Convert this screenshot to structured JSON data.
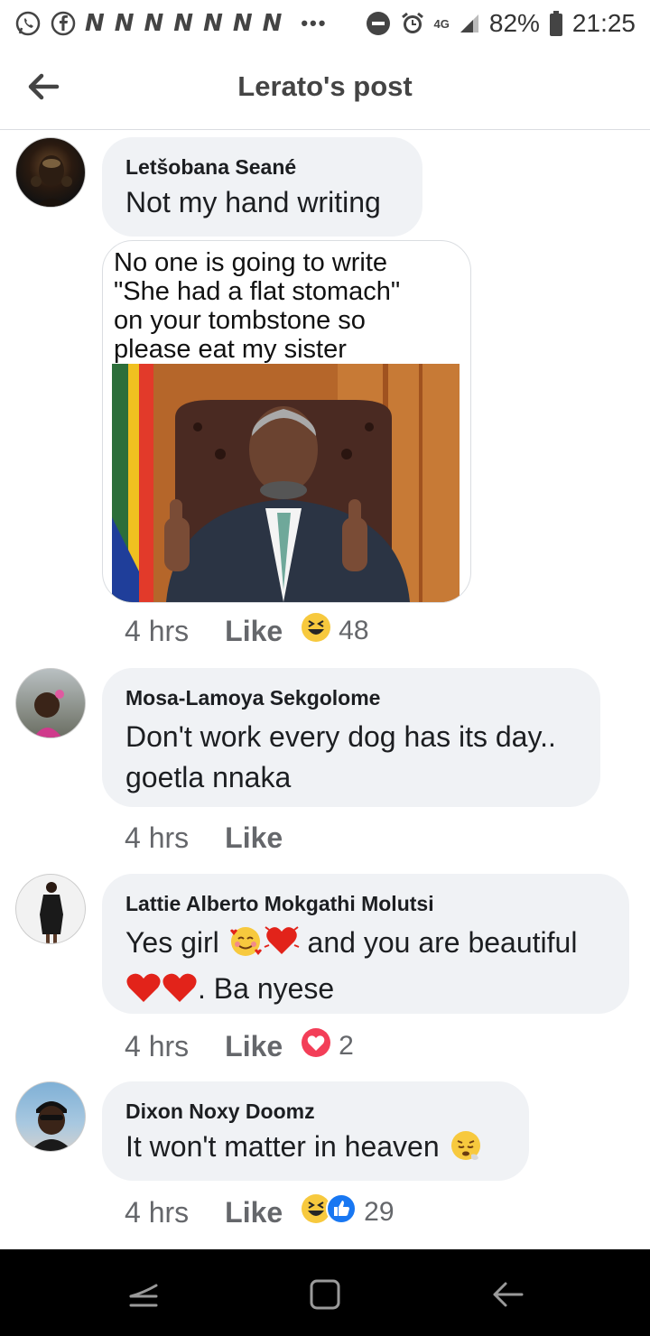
{
  "status_bar": {
    "notification_letters": [
      "N",
      "N",
      "N",
      "N",
      "N",
      "N",
      "N"
    ],
    "more_indicator": "•••",
    "network": "4G",
    "battery": "82%",
    "time": "21:25"
  },
  "header": {
    "title": "Lerato's post"
  },
  "comments": [
    {
      "author": "Letšobana Seané",
      "text": "Not my hand writing",
      "meme_text": "No one is going to write\n\"She had a flat stomach\"\non your tombstone so\nplease eat my sister",
      "time": "4 hrs",
      "like_label": "Like",
      "reaction_count": "48"
    },
    {
      "author": "Mosa-Lamoya Sekgolome",
      "text_line1": "Don't work every dog has its day..",
      "text_line2": "goetla nnaka",
      "time": "4 hrs",
      "like_label": "Like"
    },
    {
      "author": "Lattie Alberto Mokgathi Molutsi",
      "text_a": "Yes girl ",
      "text_b": " and you are beautiful",
      "text_c": ". Ba nyese",
      "time": "4 hrs",
      "like_label": "Like",
      "reaction_count": "2"
    },
    {
      "author": "Dixon Noxy Doomz",
      "text": "It won't matter in heaven ",
      "time": "4 hrs",
      "like_label": "Like",
      "reaction_count": "29"
    }
  ],
  "colors": {
    "bubble_bg": "#f0f2f5",
    "text_primary": "#1c1e21",
    "text_secondary": "#65676b",
    "like_blue": "#1877f2",
    "love_red": "#f33e58",
    "haha_yellow": "#f7c93e"
  }
}
